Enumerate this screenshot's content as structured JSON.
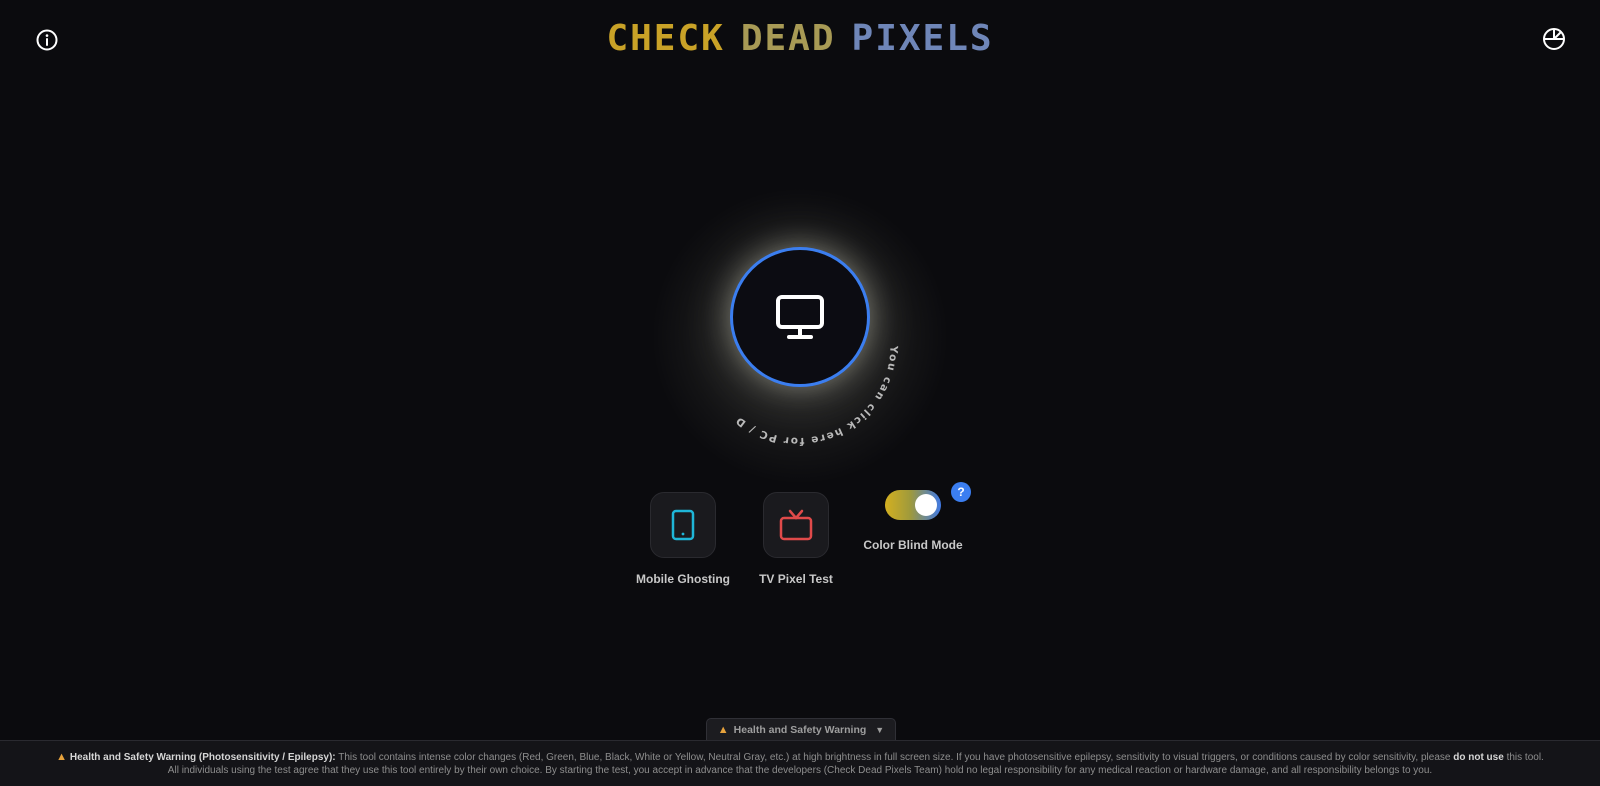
{
  "header": {
    "title_part1": "CHECK",
    "title_part2": "DEAD",
    "title_part3": "PIXELS",
    "info_icon": "info-icon",
    "theme_icon": "theme-toggle-icon"
  },
  "main": {
    "desktop_icon": "monitor-icon",
    "arc_text": "You can click here for PC / Desktop"
  },
  "options": {
    "mobile_label": "Mobile Ghosting",
    "tv_label": "TV Pixel Test",
    "colorblind_label": "Color Blind Mode",
    "colorblind_enabled": true,
    "help_label": "?"
  },
  "warning": {
    "tab_label": "Health and Safety Warning",
    "tab_arrow": "▼",
    "heading": "Health and Safety Warning (Photosensitivity / Epilepsy):",
    "line1_a": "This tool contains intense color changes (Red, Green, Blue, Black, White or Yellow, Neutral Gray, etc.) at high brightness in full screen size. If you have photosensitive epilepsy, sensitivity to visual triggers, or conditions caused by color sensitivity, please",
    "line1_bold": "do not use",
    "line1_b": "this tool.",
    "line2": "All individuals using the test agree that they use this tool entirely by their own choice. By starting the test, you accept in advance that the developers (Check Dead Pixels Team) hold no legal responsibility for any medical reaction or hardware damage, and all responsibility belongs to you."
  },
  "colors": {
    "accent_blue": "#3b7ef0",
    "title_yellow": "#c9a227",
    "title_olive": "#a89a55",
    "title_blue": "#6f86b8",
    "mobile_icon": "#1fb6d8",
    "tv_icon": "#e04a4a",
    "warning_orange": "#e6a23c"
  }
}
